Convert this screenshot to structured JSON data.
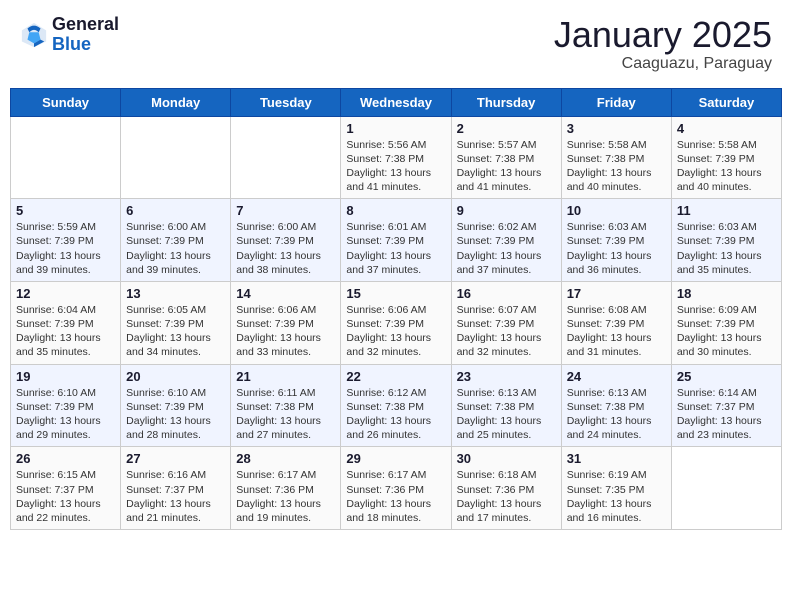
{
  "header": {
    "logo_general": "General",
    "logo_blue": "Blue",
    "month_year": "January 2025",
    "location": "Caaguazu, Paraguay"
  },
  "days_of_week": [
    "Sunday",
    "Monday",
    "Tuesday",
    "Wednesday",
    "Thursday",
    "Friday",
    "Saturday"
  ],
  "weeks": [
    [
      {
        "day": "",
        "info": ""
      },
      {
        "day": "",
        "info": ""
      },
      {
        "day": "",
        "info": ""
      },
      {
        "day": "1",
        "info": "Sunrise: 5:56 AM\nSunset: 7:38 PM\nDaylight: 13 hours\nand 41 minutes."
      },
      {
        "day": "2",
        "info": "Sunrise: 5:57 AM\nSunset: 7:38 PM\nDaylight: 13 hours\nand 41 minutes."
      },
      {
        "day": "3",
        "info": "Sunrise: 5:58 AM\nSunset: 7:38 PM\nDaylight: 13 hours\nand 40 minutes."
      },
      {
        "day": "4",
        "info": "Sunrise: 5:58 AM\nSunset: 7:39 PM\nDaylight: 13 hours\nand 40 minutes."
      }
    ],
    [
      {
        "day": "5",
        "info": "Sunrise: 5:59 AM\nSunset: 7:39 PM\nDaylight: 13 hours\nand 39 minutes."
      },
      {
        "day": "6",
        "info": "Sunrise: 6:00 AM\nSunset: 7:39 PM\nDaylight: 13 hours\nand 39 minutes."
      },
      {
        "day": "7",
        "info": "Sunrise: 6:00 AM\nSunset: 7:39 PM\nDaylight: 13 hours\nand 38 minutes."
      },
      {
        "day": "8",
        "info": "Sunrise: 6:01 AM\nSunset: 7:39 PM\nDaylight: 13 hours\nand 37 minutes."
      },
      {
        "day": "9",
        "info": "Sunrise: 6:02 AM\nSunset: 7:39 PM\nDaylight: 13 hours\nand 37 minutes."
      },
      {
        "day": "10",
        "info": "Sunrise: 6:03 AM\nSunset: 7:39 PM\nDaylight: 13 hours\nand 36 minutes."
      },
      {
        "day": "11",
        "info": "Sunrise: 6:03 AM\nSunset: 7:39 PM\nDaylight: 13 hours\nand 35 minutes."
      }
    ],
    [
      {
        "day": "12",
        "info": "Sunrise: 6:04 AM\nSunset: 7:39 PM\nDaylight: 13 hours\nand 35 minutes."
      },
      {
        "day": "13",
        "info": "Sunrise: 6:05 AM\nSunset: 7:39 PM\nDaylight: 13 hours\nand 34 minutes."
      },
      {
        "day": "14",
        "info": "Sunrise: 6:06 AM\nSunset: 7:39 PM\nDaylight: 13 hours\nand 33 minutes."
      },
      {
        "day": "15",
        "info": "Sunrise: 6:06 AM\nSunset: 7:39 PM\nDaylight: 13 hours\nand 32 minutes."
      },
      {
        "day": "16",
        "info": "Sunrise: 6:07 AM\nSunset: 7:39 PM\nDaylight: 13 hours\nand 32 minutes."
      },
      {
        "day": "17",
        "info": "Sunrise: 6:08 AM\nSunset: 7:39 PM\nDaylight: 13 hours\nand 31 minutes."
      },
      {
        "day": "18",
        "info": "Sunrise: 6:09 AM\nSunset: 7:39 PM\nDaylight: 13 hours\nand 30 minutes."
      }
    ],
    [
      {
        "day": "19",
        "info": "Sunrise: 6:10 AM\nSunset: 7:39 PM\nDaylight: 13 hours\nand 29 minutes."
      },
      {
        "day": "20",
        "info": "Sunrise: 6:10 AM\nSunset: 7:39 PM\nDaylight: 13 hours\nand 28 minutes."
      },
      {
        "day": "21",
        "info": "Sunrise: 6:11 AM\nSunset: 7:38 PM\nDaylight: 13 hours\nand 27 minutes."
      },
      {
        "day": "22",
        "info": "Sunrise: 6:12 AM\nSunset: 7:38 PM\nDaylight: 13 hours\nand 26 minutes."
      },
      {
        "day": "23",
        "info": "Sunrise: 6:13 AM\nSunset: 7:38 PM\nDaylight: 13 hours\nand 25 minutes."
      },
      {
        "day": "24",
        "info": "Sunrise: 6:13 AM\nSunset: 7:38 PM\nDaylight: 13 hours\nand 24 minutes."
      },
      {
        "day": "25",
        "info": "Sunrise: 6:14 AM\nSunset: 7:37 PM\nDaylight: 13 hours\nand 23 minutes."
      }
    ],
    [
      {
        "day": "26",
        "info": "Sunrise: 6:15 AM\nSunset: 7:37 PM\nDaylight: 13 hours\nand 22 minutes."
      },
      {
        "day": "27",
        "info": "Sunrise: 6:16 AM\nSunset: 7:37 PM\nDaylight: 13 hours\nand 21 minutes."
      },
      {
        "day": "28",
        "info": "Sunrise: 6:17 AM\nSunset: 7:36 PM\nDaylight: 13 hours\nand 19 minutes."
      },
      {
        "day": "29",
        "info": "Sunrise: 6:17 AM\nSunset: 7:36 PM\nDaylight: 13 hours\nand 18 minutes."
      },
      {
        "day": "30",
        "info": "Sunrise: 6:18 AM\nSunset: 7:36 PM\nDaylight: 13 hours\nand 17 minutes."
      },
      {
        "day": "31",
        "info": "Sunrise: 6:19 AM\nSunset: 7:35 PM\nDaylight: 13 hours\nand 16 minutes."
      },
      {
        "day": "",
        "info": ""
      }
    ]
  ]
}
